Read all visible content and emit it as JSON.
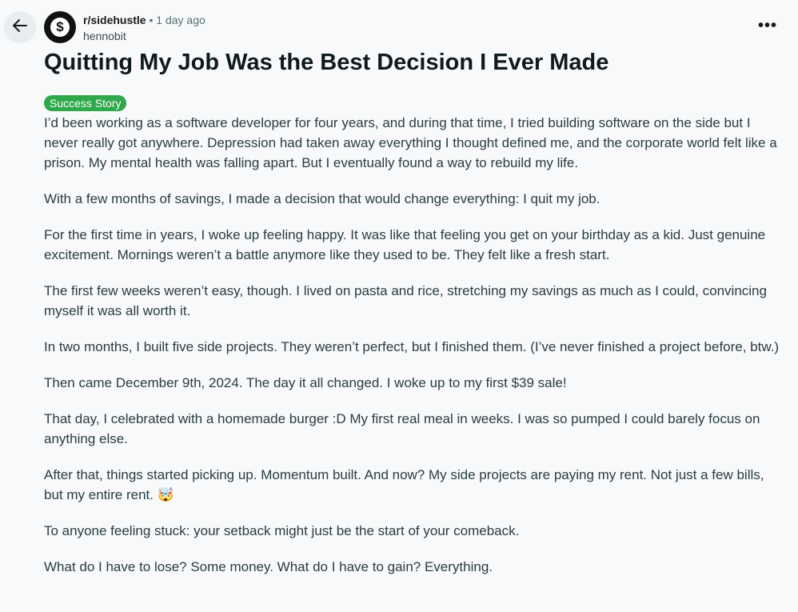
{
  "post": {
    "subreddit": "r/sidehustle",
    "separator": "•",
    "time": "1 day ago",
    "author": "hennobit",
    "title": "Quitting My Job Was the Best Decision I Ever Made",
    "flair": "Success Story",
    "paragraphs": [
      "I’d been working as a software developer for four years, and during that time, I tried building software on the side but I never really got anywhere. Depression had taken away everything I thought defined me, and the corporate world felt like a prison. My mental health was falling apart. But I eventually found a way to rebuild my life.",
      "With a few months of savings, I made a decision that would change everything: I quit my job.",
      "For the first time in years, I woke up feeling happy. It was like that feeling you get on your birthday as a kid. Just genuine excitement. Mornings weren’t a battle anymore like they used to be. They felt like a fresh start.",
      "The first few weeks weren’t easy, though. I lived on pasta and rice, stretching my savings as much as I could, convincing myself it was all worth it.",
      "In two months, I built five side projects. They weren’t perfect, but I finished them. (I’ve never finished a project before, btw.)",
      "Then came December 9th, 2024. The day it all changed. I woke up to my first $39 sale!",
      "That day, I celebrated with a homemade burger :D My first real meal in weeks. I was so pumped I could barely focus on anything else.",
      "After that, things started picking up. Momentum built. And now? My side projects are paying my rent. Not just a few bills, but my entire rent. 🤯",
      "To anyone feeling stuck: your setback might just be the start of your comeback.",
      "What do I have to lose? Some money. What do I have to gain? Everything."
    ]
  },
  "icons": {
    "back": "arrow-left-icon",
    "avatar_symbol": "$",
    "overflow": "•••"
  },
  "colors": {
    "flair_bg": "#2ea84a",
    "back_bg": "#e9edf0",
    "avatar_bg": "#111111"
  }
}
